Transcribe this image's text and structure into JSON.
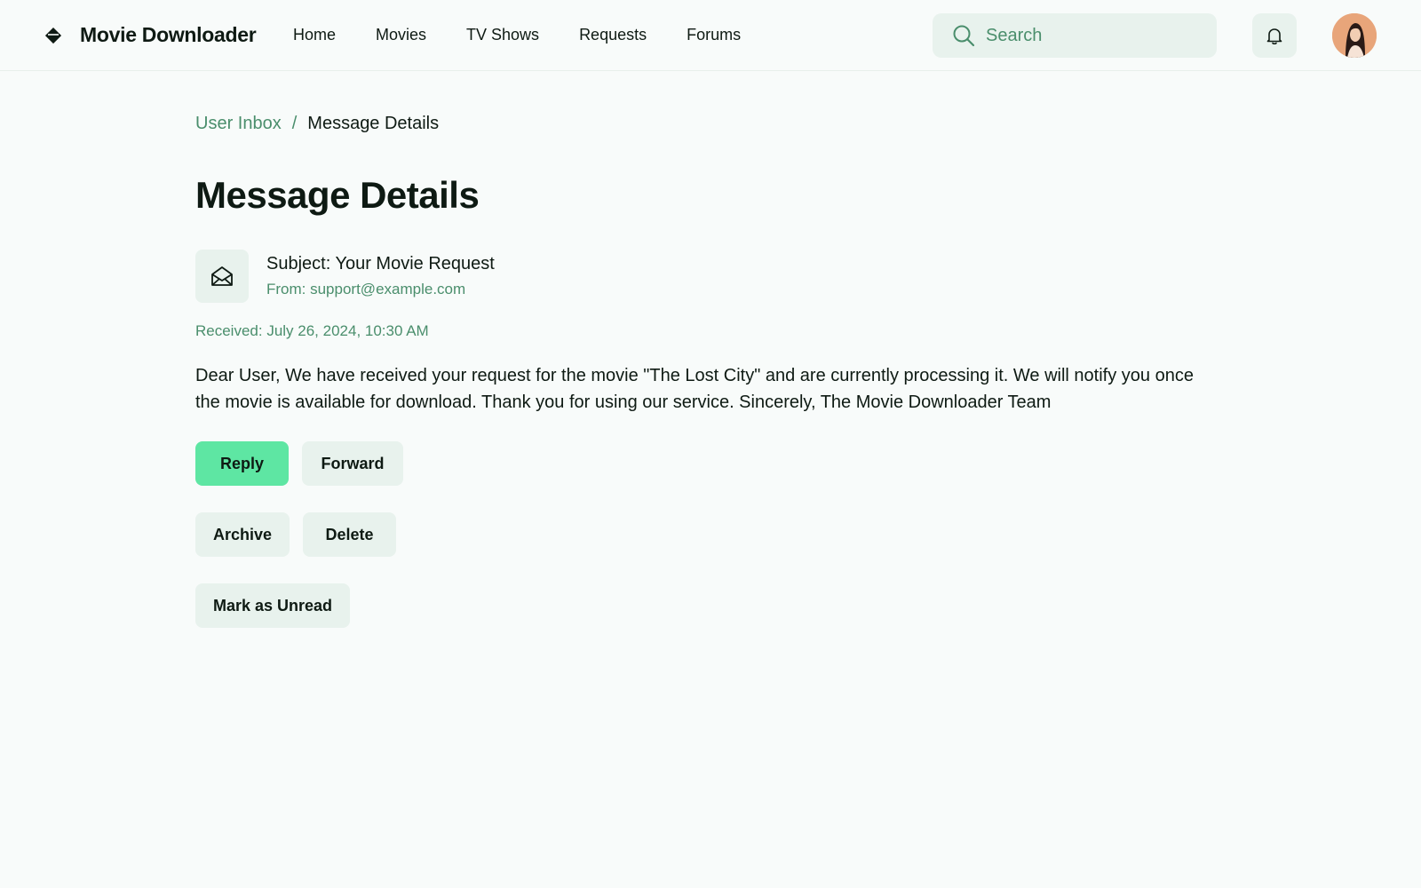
{
  "header": {
    "brand": "Movie Downloader",
    "nav": [
      "Home",
      "Movies",
      "TV Shows",
      "Requests",
      "Forums"
    ],
    "search_placeholder": "Search"
  },
  "breadcrumb": {
    "parent": "User Inbox",
    "separator": "/",
    "current": "Message Details"
  },
  "page_title": "Message Details",
  "message": {
    "subject": "Subject: Your Movie Request",
    "from": "From: support@example.com",
    "received": "Received: July 26, 2024, 10:30 AM",
    "body": "Dear User, We have received your request for the movie \"The Lost City\" and are currently processing it. We will notify you once the movie is available for download. Thank you for using our service. Sincerely, The Movie Downloader Team"
  },
  "actions": {
    "reply": "Reply",
    "forward": "Forward",
    "archive": "Archive",
    "delete": "Delete",
    "mark_unread": "Mark as Unread"
  },
  "colors": {
    "background": "#f8fbfa",
    "accent": "#5ee6a3",
    "secondary_button": "#e8f2ed",
    "muted_green_text": "#4a8e6c",
    "text": "#0e1a13"
  },
  "icons": [
    "diamond-logo-icon",
    "search-icon",
    "bell-icon",
    "mail-open-icon"
  ]
}
